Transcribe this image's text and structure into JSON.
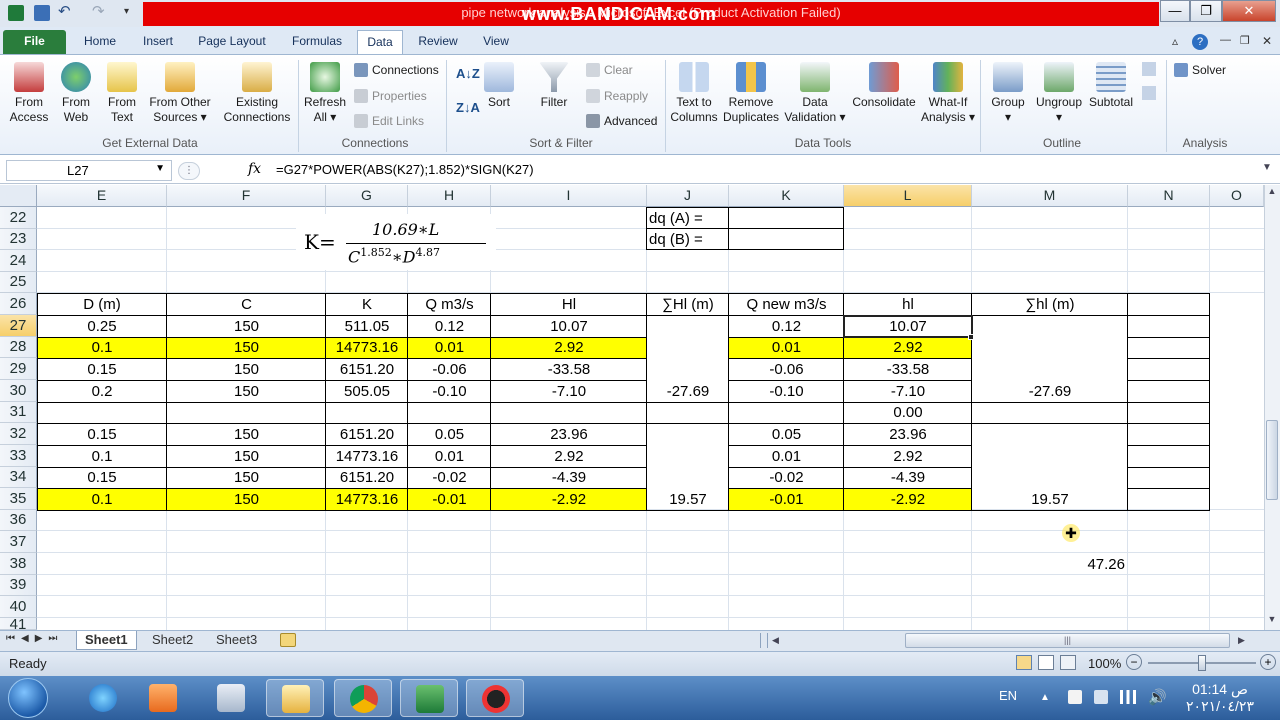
{
  "window": {
    "title": "pipe network analysis - Microsoft Excel (Product Activation Failed)",
    "watermark": "www.BANDICAM.com",
    "controls": {
      "minimize": "—",
      "maximize": "❐",
      "close": "✕"
    }
  },
  "ribbon": {
    "tabs": [
      "File",
      "Home",
      "Insert",
      "Page Layout",
      "Formulas",
      "Data",
      "Review",
      "View"
    ],
    "active_tab": "Data",
    "groups": {
      "get_external_data": {
        "label": "Get External Data",
        "from_access": "From\nAccess",
        "from_web": "From\nWeb",
        "from_text": "From\nText",
        "from_other": "From Other\nSources ▾",
        "existing": "Existing\nConnections"
      },
      "connections": {
        "label": "Connections",
        "refresh": "Refresh\nAll ▾",
        "connections": "Connections",
        "properties": "Properties",
        "edit_links": "Edit Links"
      },
      "sort_filter": {
        "label": "Sort & Filter",
        "sort": "Sort",
        "filter": "Filter",
        "clear": "Clear",
        "reapply": "Reapply",
        "advanced": "Advanced"
      },
      "data_tools": {
        "label": "Data Tools",
        "text_to_columns": "Text to\nColumns",
        "remove_duplicates": "Remove\nDuplicates",
        "data_validation": "Data\nValidation ▾",
        "consolidate": "Consolidate",
        "what_if": "What-If\nAnalysis ▾"
      },
      "outline": {
        "label": "Outline",
        "group": "Group\n▾",
        "ungroup": "Ungroup\n▾",
        "subtotal": "Subtotal"
      },
      "analysis": {
        "label": "Analysis",
        "solver": "Solver"
      }
    }
  },
  "formula_bar": {
    "name_box": "L27",
    "fx": "fx",
    "formula": "=G27*POWER(ABS(K27);1.852)*SIGN(K27)"
  },
  "sheet": {
    "columns": [
      "E",
      "F",
      "G",
      "H",
      "I",
      "J",
      "K",
      "L",
      "M",
      "N",
      "O"
    ],
    "selected_column": "L",
    "rows": [
      "22",
      "23",
      "24",
      "25",
      "26",
      "27",
      "28",
      "29",
      "30",
      "31",
      "32",
      "33",
      "34",
      "35",
      "36",
      "37",
      "38",
      "39",
      "40",
      "41"
    ],
    "selected_row": "27",
    "formula_image": {
      "lhs": "K=",
      "num": "10.69∗L",
      "den_c": "C",
      "den_c_exp": "1.852",
      "den_op": "∗",
      "den_d": "D",
      "den_d_exp": "4.87"
    },
    "dq_a": "dq (A) =",
    "dq_b": "dq (B) =",
    "headers": [
      "D  (m)",
      "C",
      "K",
      "Q  m3/s",
      "Hl",
      "∑Hl  (m)",
      "Q new  m3/s",
      "hl",
      "∑hl  (m)"
    ],
    "table_rows": [
      {
        "row": "27",
        "D": "0.25",
        "C": "150",
        "K": "511.05",
        "Q": "0.12",
        "Hl": "10.07",
        "Qn": "0.12",
        "hl": "10.07",
        "yellow": false
      },
      {
        "row": "28",
        "D": "0.1",
        "C": "150",
        "K": "14773.16",
        "Q": "0.01",
        "Hl": "2.92",
        "Qn": "0.01",
        "hl": "2.92",
        "yellow": true
      },
      {
        "row": "29",
        "D": "0.15",
        "C": "150",
        "K": "6151.20",
        "Q": "-0.06",
        "Hl": "-33.58",
        "Qn": "-0.06",
        "hl": "-33.58",
        "yellow": false
      },
      {
        "row": "30",
        "D": "0.2",
        "C": "150",
        "K": "505.05",
        "Q": "-0.10",
        "Hl": "-7.10",
        "Qn": "-0.10",
        "hl": "-7.10",
        "yellow": false
      },
      {
        "row": "31",
        "D": "",
        "C": "",
        "K": "",
        "Q": "",
        "Hl": "",
        "Qn": "",
        "hl": "0.00",
        "yellow": false
      },
      {
        "row": "32",
        "D": "0.15",
        "C": "150",
        "K": "6151.20",
        "Q": "0.05",
        "Hl": "23.96",
        "Qn": "0.05",
        "hl": "23.96",
        "yellow": false
      },
      {
        "row": "33",
        "D": "0.1",
        "C": "150",
        "K": "14773.16",
        "Q": "0.01",
        "Hl": "2.92",
        "Qn": "0.01",
        "hl": "2.92",
        "yellow": false
      },
      {
        "row": "34",
        "D": "0.15",
        "C": "150",
        "K": "6151.20",
        "Q": "-0.02",
        "Hl": "-4.39",
        "Qn": "-0.02",
        "hl": "-4.39",
        "yellow": false
      },
      {
        "row": "35",
        "D": "0.1",
        "C": "150",
        "K": "14773.16",
        "Q": "-0.01",
        "Hl": "-2.92",
        "Qn": "-0.01",
        "hl": "-2.92",
        "yellow": true
      }
    ],
    "sum_hl_loop1": "-27.69",
    "sum_hl_loop2": "19.57",
    "sum_hl_new_loop1": "-27.69",
    "sum_hl_new_loop2": "19.57",
    "n38": "47.26"
  },
  "sheet_tabs": [
    "Sheet1",
    "Sheet2",
    "Sheet3"
  ],
  "active_sheet": "Sheet1",
  "status": {
    "ready": "Ready",
    "zoom": "100%"
  },
  "taskbar": {
    "lang": "EN",
    "time": "01:14 ص",
    "date": "٢٠٢١/٠٤/٢٣"
  },
  "colors": {
    "yellow": "#ffff00",
    "selection": "#f6cf6a",
    "excel_green": "#2a7d3c",
    "red_bar": "#e60000"
  }
}
